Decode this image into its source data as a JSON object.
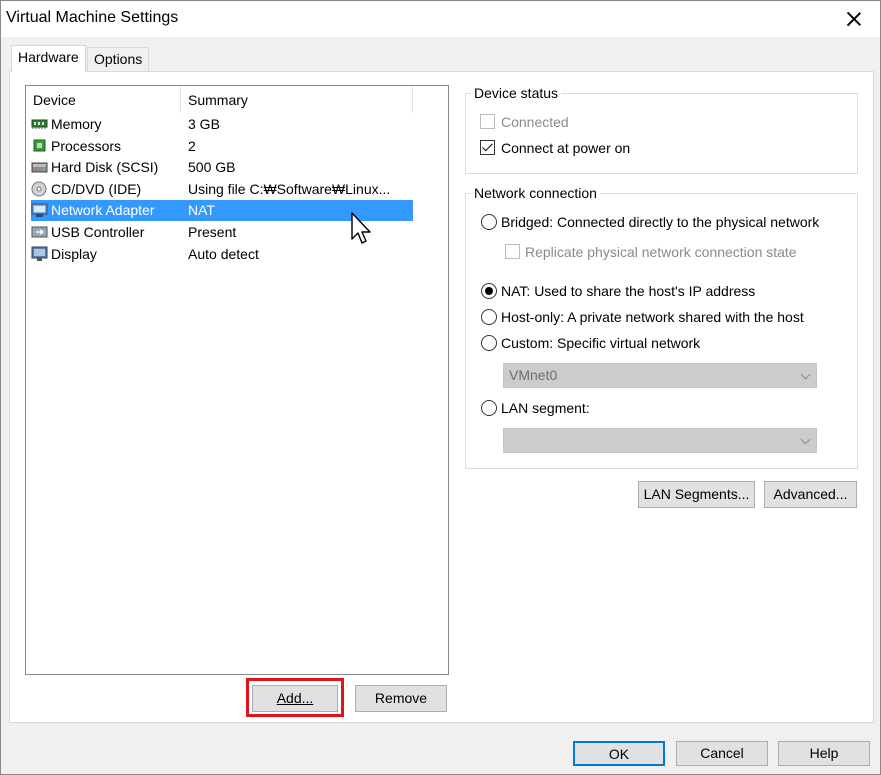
{
  "window": {
    "title": "Virtual Machine Settings"
  },
  "tabs": [
    {
      "label": "Hardware",
      "active": true
    },
    {
      "label": "Options",
      "active": false
    }
  ],
  "device_list": {
    "columns": [
      "Device",
      "Summary"
    ],
    "rows": [
      {
        "device": "Memory",
        "summary": "3 GB",
        "icon": "memory-icon"
      },
      {
        "device": "Processors",
        "summary": "2",
        "icon": "processor-icon"
      },
      {
        "device": "Hard Disk (SCSI)",
        "summary": "500 GB",
        "icon": "hard-disk-icon"
      },
      {
        "device": "CD/DVD (IDE)",
        "summary": "Using file C:₩Software₩Linux...",
        "icon": "cd-dvd-icon"
      },
      {
        "device": "Network Adapter",
        "summary": "NAT",
        "icon": "network-adapter-icon",
        "selected": true
      },
      {
        "device": "USB Controller",
        "summary": "Present",
        "icon": "usb-icon"
      },
      {
        "device": "Display",
        "summary": "Auto detect",
        "icon": "display-icon"
      }
    ]
  },
  "list_buttons": {
    "add": "Add...",
    "remove": "Remove"
  },
  "device_status": {
    "label": "Device status",
    "connected": {
      "label": "Connected",
      "checked": false,
      "enabled": false
    },
    "connect_at_power_on": {
      "label": "Connect at power on",
      "checked": true,
      "enabled": true
    }
  },
  "network_connection": {
    "label": "Network connection",
    "bridged": "Bridged: Connected directly to the physical network",
    "replicate": "Replicate physical network connection state",
    "nat": "NAT: Used to share the host's IP address",
    "host_only": "Host-only: A private network shared with the host",
    "custom": "Custom: Specific virtual network",
    "custom_select": "VMnet0",
    "lan_segment": "LAN segment:",
    "lan_select": "",
    "selected": "nat"
  },
  "net_buttons": {
    "lan_segments": "LAN Segments...",
    "advanced": "Advanced..."
  },
  "footer": {
    "ok": "OK",
    "cancel": "Cancel",
    "help": "Help"
  },
  "colors": {
    "selection": "#3399ff",
    "highlight_box": "#e0151b",
    "default_button_border": "#0078d7"
  }
}
